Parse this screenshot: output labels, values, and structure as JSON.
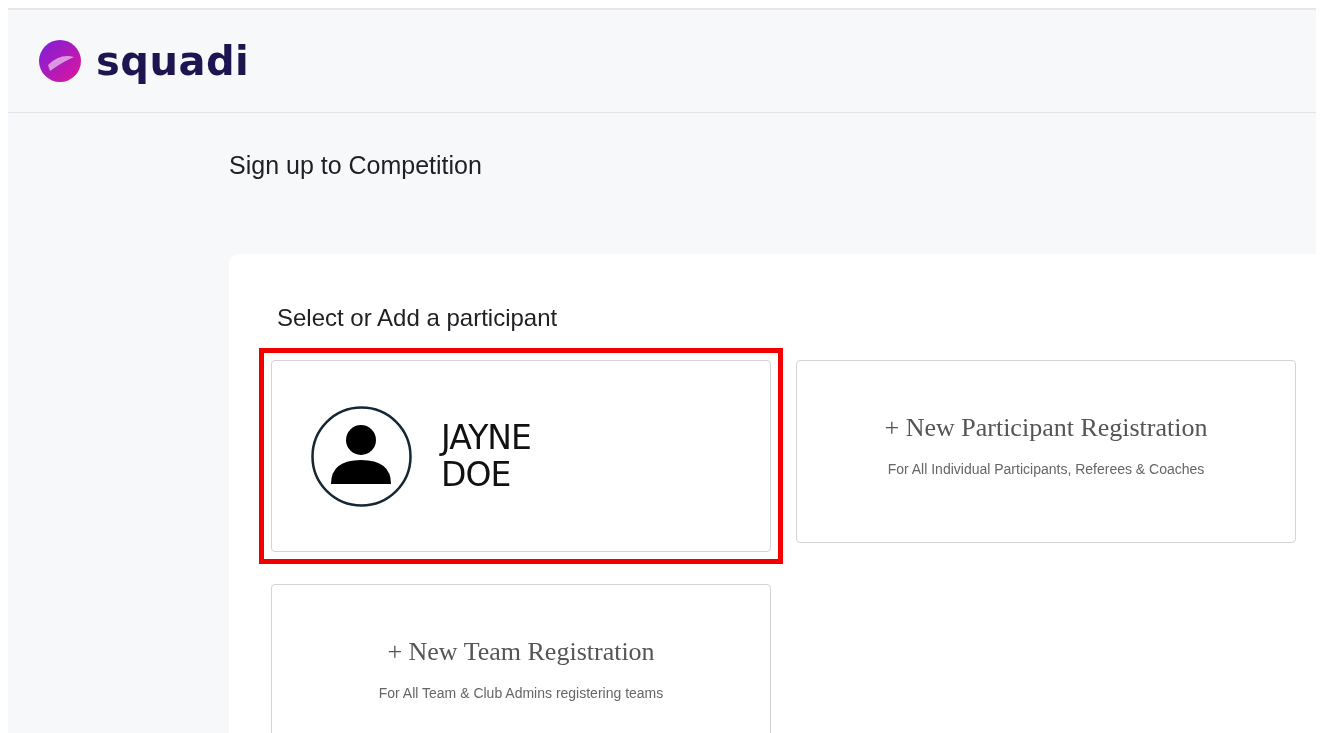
{
  "header": {
    "logo_text": "squadi"
  },
  "page_title": "Sign up to Competition",
  "panel": {
    "heading": "Select or Add a participant",
    "options": [
      {
        "kind": "participant",
        "name": "JAYNE DOE",
        "selected": true
      },
      {
        "kind": "new",
        "title": "+ New Participant Registration",
        "subtitle": "For All Individual Participants, Referees & Coaches",
        "selected": false
      },
      {
        "kind": "new",
        "title": "+ New Team Registration",
        "subtitle": "For All Team & Club Admins registering teams",
        "selected": false
      }
    ]
  }
}
